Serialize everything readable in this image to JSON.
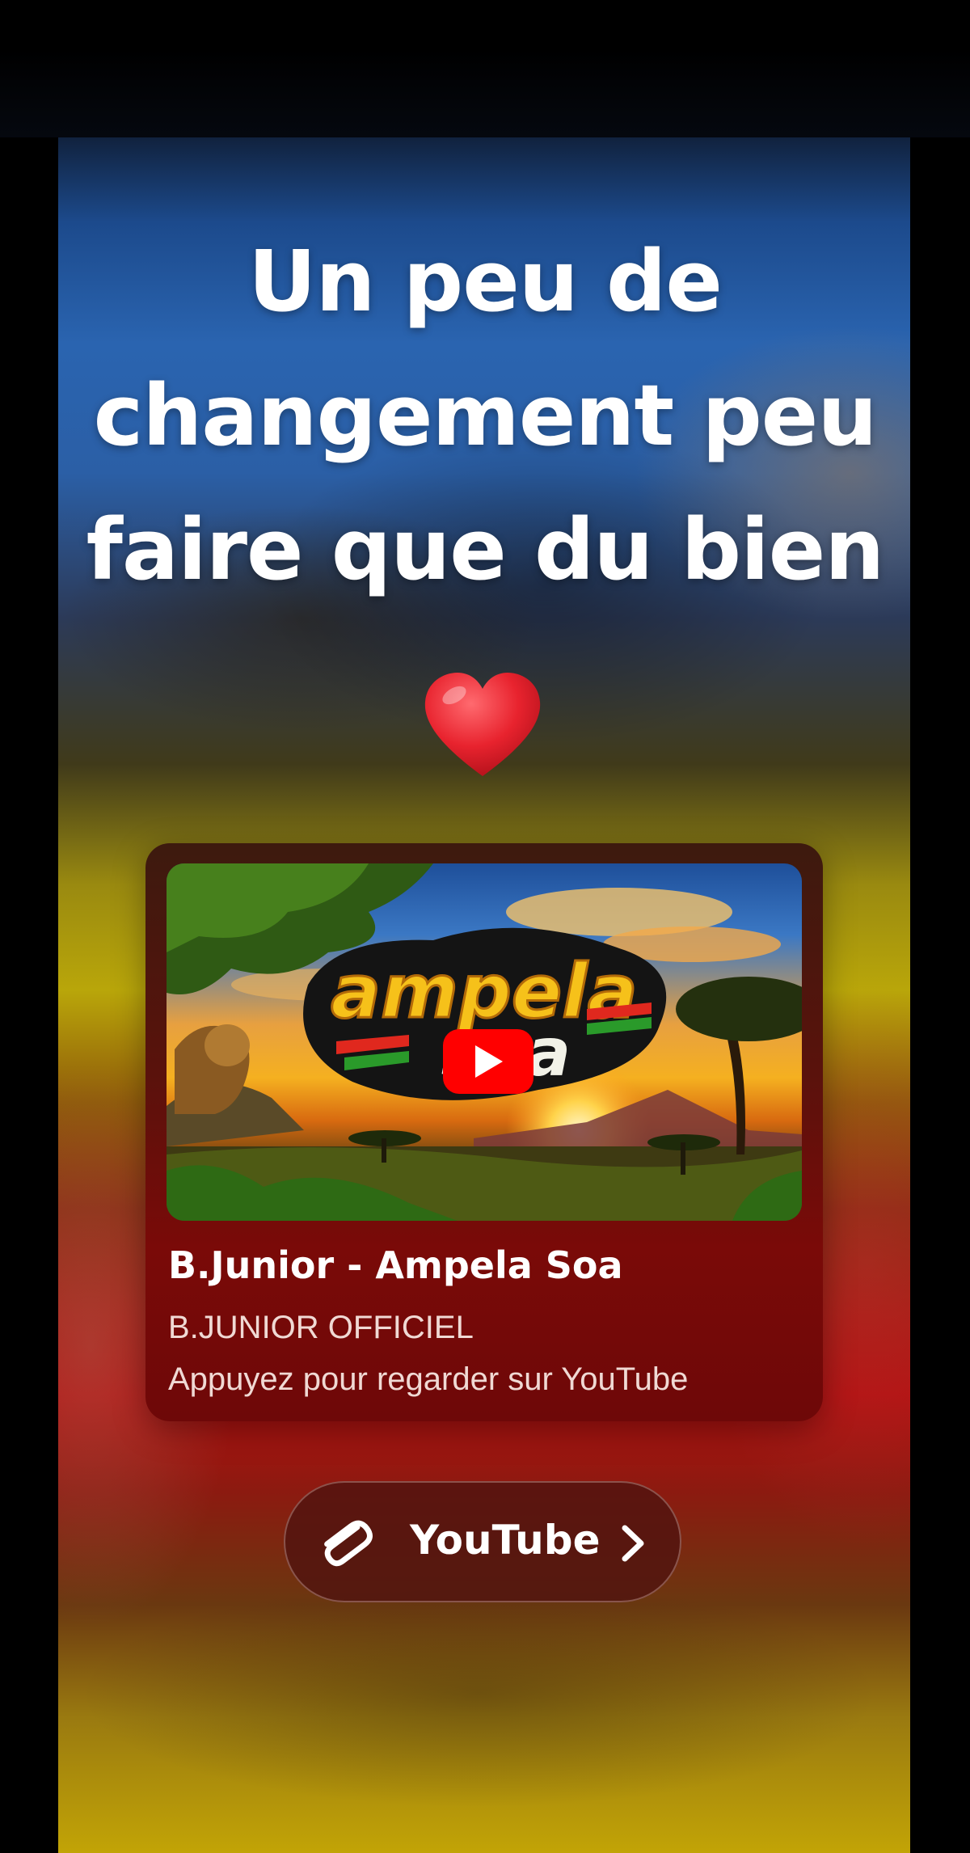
{
  "story": {
    "headline_lines": [
      "Un peu de",
      "changement peu",
      "faire que du bien"
    ],
    "emoji": "heart-icon"
  },
  "youtube_card": {
    "thumbnail_text": "ampela soa",
    "title": "B.Junior - Ampela Soa",
    "channel": "B.JUNIOR OFFICIEL",
    "hint": "Appuyez pour regarder sur YouTube",
    "play_icon": "play-icon",
    "play_color": "#ff0000"
  },
  "link_sticker": {
    "label": "YouTube",
    "icon": "paperclip-icon",
    "chevron": "chevron-right-icon"
  },
  "colors": {
    "heart": "#e8232e",
    "text": "#ffffff"
  }
}
